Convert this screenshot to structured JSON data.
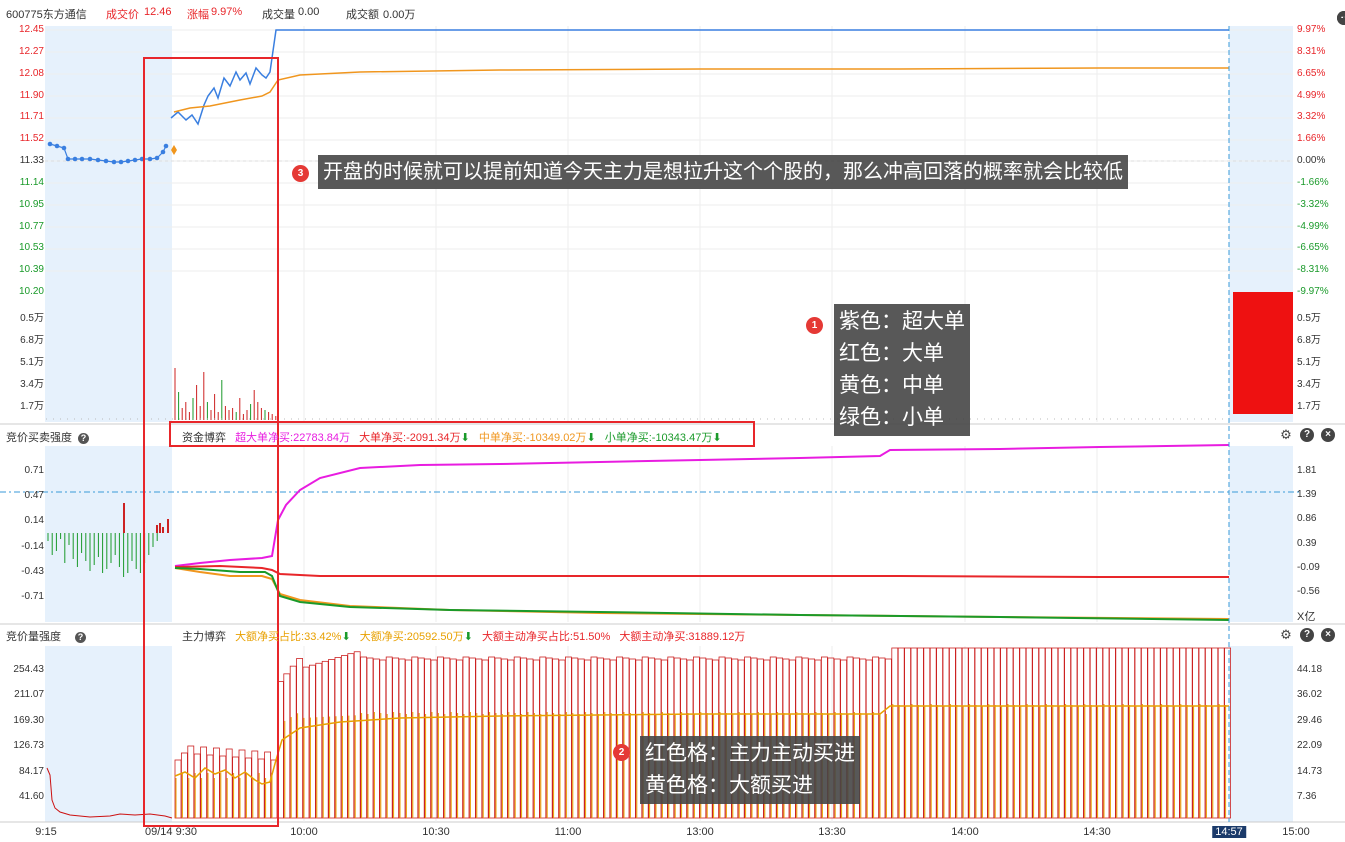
{
  "header": {
    "stock": "600775东方通信",
    "price_label": "成交价",
    "price": "12.46",
    "change_label": "涨幅",
    "change": "9.97%",
    "volume_label": "成交量",
    "volume": "0.00",
    "amount_label": "成交额",
    "amount": "0.00万"
  },
  "price_axis_left": [
    "12.45",
    "12.27",
    "12.08",
    "11.90",
    "11.71",
    "11.52",
    "11.33",
    "11.14",
    "10.95",
    "10.77",
    "10.53",
    "10.39",
    "10.20"
  ],
  "price_axis_right": [
    "9.97%",
    "8.31%",
    "6.65%",
    "4.99%",
    "3.32%",
    "1.66%",
    "0.00%",
    "-1.66%",
    "-3.32%",
    "-4.99%",
    "-6.65%",
    "-8.31%",
    "-9.97%"
  ],
  "vol_axis": [
    "0.5万",
    "6.8万",
    "5.1万",
    "3.4万",
    "1.7万"
  ],
  "panel2": {
    "title": "竞价买卖强度",
    "fund_label": "资金博弈",
    "super": "超大单净买:22783.84万",
    "big": "大单净买:-2091.34万",
    "mid": "中单净买:-10349.02万",
    "small": "小单净买:-10343.47万",
    "left_axis": [
      "0.71",
      "0.47",
      "0.14",
      "-0.14",
      "-0.43",
      "-0.71"
    ],
    "right_axis": [
      "1.81",
      "1.39",
      "0.86",
      "0.39",
      "-0.09",
      "-0.56"
    ],
    "unit": "X亿"
  },
  "panel3": {
    "title": "竞价量强度",
    "main_label": "主力博弈",
    "m1": "大额净买占比:33.42%",
    "m2": "大额净买:20592.50万",
    "m3": "大额主动净买占比:51.50%",
    "m4": "大额主动净买:31889.12万",
    "left_axis": [
      "254.43",
      "211.07",
      "169.30",
      "126.73",
      "84.17",
      "41.60"
    ],
    "right_axis": [
      "44.18",
      "36.02",
      "29.46",
      "22.09",
      "14.73",
      "7.36"
    ]
  },
  "time_axis": [
    "9:15",
    "09/14 9:30",
    "10:00",
    "10:30",
    "11:00",
    "13:00",
    "13:30",
    "14:00",
    "14:30",
    "14:57",
    "15:00"
  ],
  "annotations": {
    "badge1": "1",
    "tip1_lines": [
      "紫色：超大单",
      "红色：大单",
      "黄色：中单",
      "绿色：小单"
    ],
    "badge2": "2",
    "tip2_lines": [
      "红色格：主力主动买进",
      "黄色格：大额买进"
    ],
    "badge3": "3",
    "tip3": "开盘的时候就可以提前知道今天主力是想拉升这个个股的，那么冲高回落的概率就会比较低"
  },
  "colors": {
    "red": "#e8262a",
    "green": "#1a9a2a",
    "blue": "#3a7fe0",
    "orange": "#f0961e",
    "magenta": "#e81ce0",
    "auction_bg": "#e6f1fc"
  }
}
